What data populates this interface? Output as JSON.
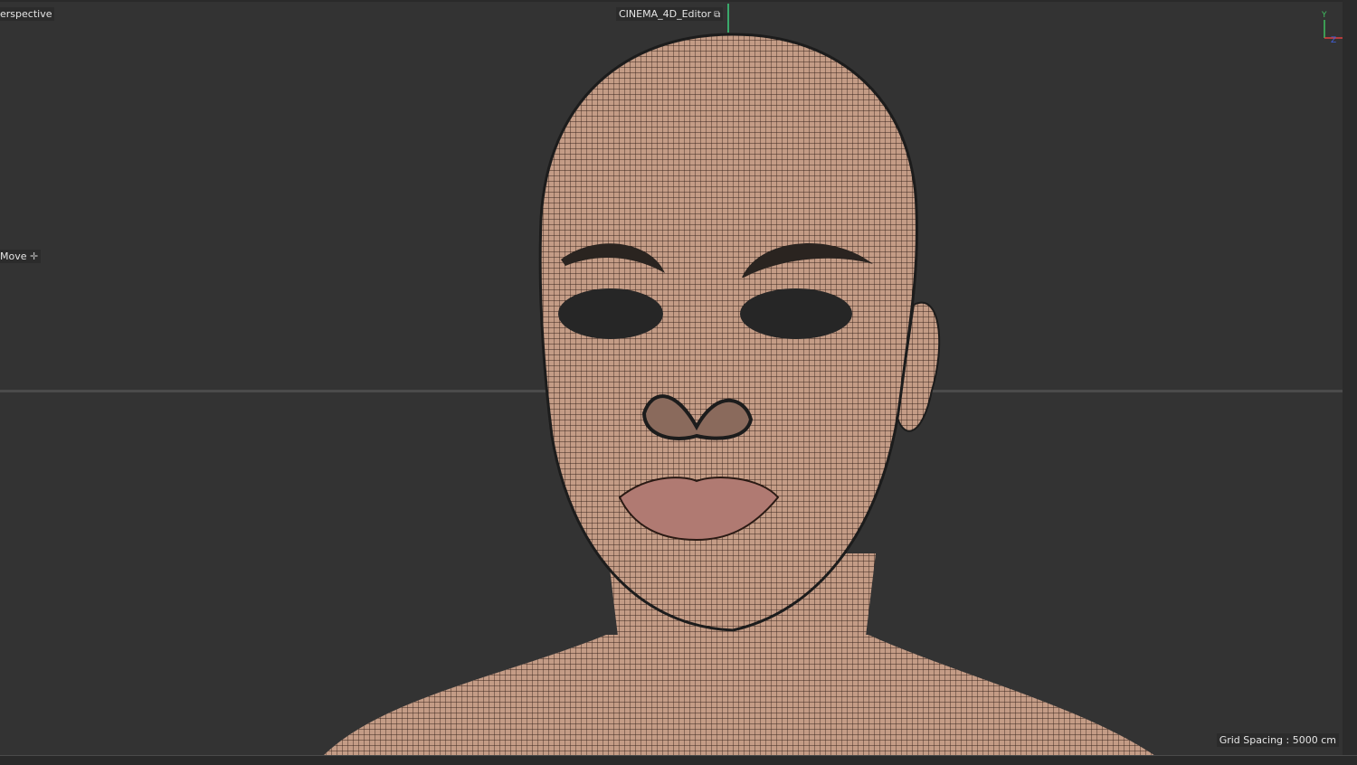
{
  "viewport": {
    "view_name": "erspective",
    "camera": "CINEMA_4D_Editor",
    "camera_icon": "camera-link-icon",
    "active_tool": "Move",
    "tool_icon": "move-cross-icon",
    "grid_spacing": "Grid Spacing : 5000 cm",
    "axis": {
      "y": "Y",
      "z": "Z",
      "x": "X"
    },
    "colors": {
      "background": "#333333",
      "mesh_skin": "#c8a08a",
      "wire": "#2a1a14",
      "lips": "#b07a72",
      "axis_x": "#e04040",
      "axis_y": "#40c060",
      "axis_z": "#4060e0"
    }
  }
}
